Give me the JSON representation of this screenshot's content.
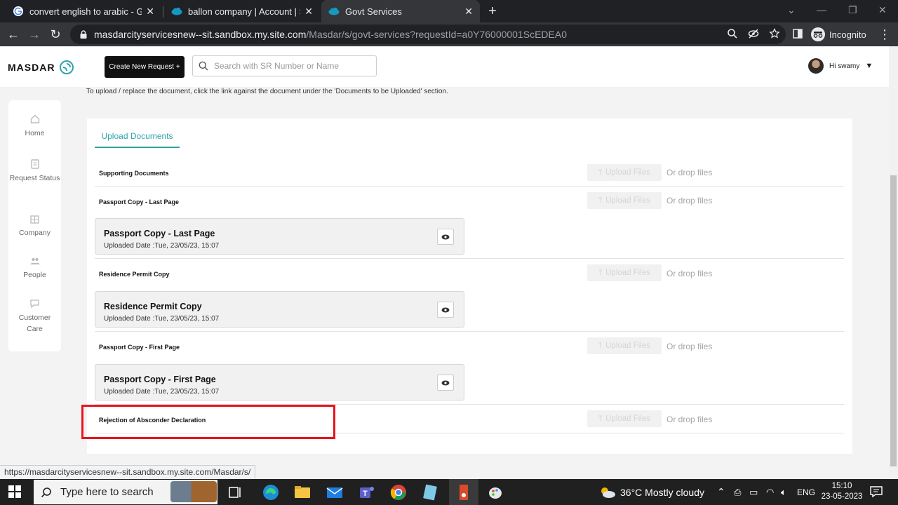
{
  "browser": {
    "tabs": [
      {
        "title": "convert english to arabic - Googl",
        "icon": "google-icon"
      },
      {
        "title": "ballon company | Account | Sales",
        "icon": "salesforce-cloud-icon"
      },
      {
        "title": "Govt Services",
        "icon": "salesforce-cloud-icon",
        "active": true
      }
    ],
    "url_host": "masdarcityservicesnew--sit.sandbox.my.site.com",
    "url_path": "/Masdar/s/govt-services?requestId=a0Y76000001ScEDEA0",
    "incognito_label": "Incognito"
  },
  "header": {
    "logo_text": "MASDAR",
    "create_button": "Create New Request +",
    "search_placeholder": "Search with SR Number or Name",
    "greeting": "Hi swamy"
  },
  "info_text": "To upload / replace the document, click the link against the document under the 'Documents to be Uploaded' section.",
  "sidebar": {
    "items": [
      {
        "label": "Home",
        "icon": "home-icon"
      },
      {
        "label": "Request Status",
        "icon": "document-icon"
      },
      {
        "label": "Company",
        "icon": "building-icon"
      },
      {
        "label": "People",
        "icon": "people-icon"
      },
      {
        "label": "Customer Care",
        "icon": "chat-icon"
      }
    ]
  },
  "upload": {
    "tab_label": "Upload Documents",
    "upload_label": "Upload Files",
    "drop_label": "Or drop files",
    "rows": [
      {
        "label": "Supporting Documents"
      },
      {
        "label": "Passport Copy - Last Page",
        "file_title": "Passport Copy - Last Page",
        "file_date": "Uploaded Date :Tue, 23/05/23, 15:07"
      },
      {
        "label": "Residence Permit Copy",
        "file_title": "Residence Permit Copy",
        "file_date": "Uploaded Date :Tue, 23/05/23, 15:07"
      },
      {
        "label": "Passport Copy - First Page",
        "file_title": "Passport Copy - First Page",
        "file_date": "Uploaded Date :Tue, 23/05/23, 15:07"
      },
      {
        "label": "Rejection of Absconder Declaration"
      }
    ]
  },
  "status_url": "https://masdarcityservicesnew--sit.sandbox.my.site.com/Masdar/s/",
  "taskbar": {
    "search_placeholder": "Type here to search",
    "weather": "36°C  Mostly cloudy",
    "language": "ENG",
    "time": "15:10",
    "date": "23-05-2023"
  },
  "colors": {
    "accent": "#2fa4a8",
    "highlight_box": "#e8141c",
    "create_button_bg": "#111111"
  }
}
